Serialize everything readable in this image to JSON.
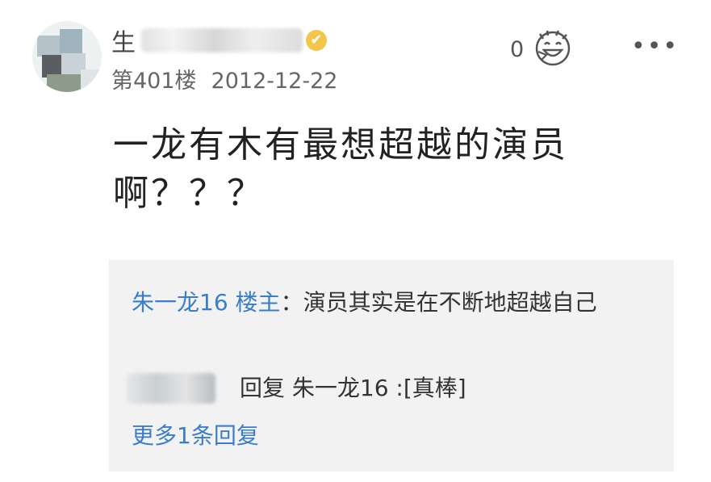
{
  "post": {
    "username_visible": "生",
    "floor": "第401楼",
    "date": "2012-12-22",
    "like_count": "0",
    "content": "一龙有木有最想超越的演员啊？？？"
  },
  "reply": {
    "author": "朱一龙16",
    "author_role": "楼主",
    "separator": "：",
    "text": "演员其实是在不断地超越自己",
    "subreply_text": "回复 朱一龙16 :[真棒]",
    "more_replies": "更多1条回复"
  },
  "icons": {
    "vip": "vip-badge-icon",
    "like": "laughing-face-like-icon",
    "more": "more-dots-icon"
  },
  "colors": {
    "link_blue": "#3a7ec9",
    "reply_bg": "#f2f2f2",
    "badge_gold": "#f3c64b"
  }
}
